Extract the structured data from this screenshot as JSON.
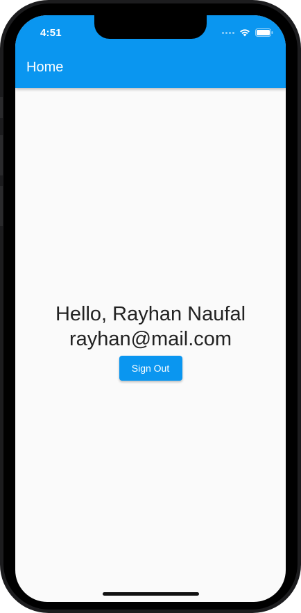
{
  "status_bar": {
    "time": "4:51"
  },
  "app_bar": {
    "title": "Home",
    "color": "#0a96f0"
  },
  "main": {
    "greeting": "Hello, Rayhan Naufal",
    "email": "rayhan@mail.com",
    "sign_out_label": "Sign Out"
  },
  "icons": {
    "wifi": "wifi-icon",
    "battery": "battery-icon",
    "signal": "cellular-signal-icon"
  }
}
